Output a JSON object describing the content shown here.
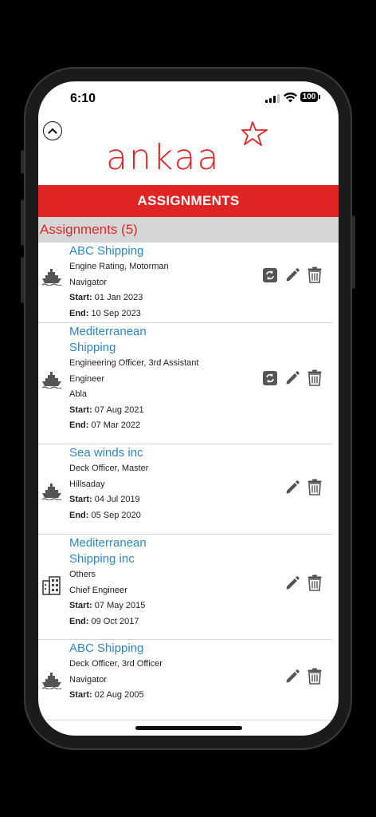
{
  "status": {
    "time": "6:10",
    "battery": "100"
  },
  "logo": {
    "text": "ankaa"
  },
  "header": {
    "banner": "ASSIGNMENTS",
    "list_title": "Assignments (5)"
  },
  "labels": {
    "start": "Start:",
    "end": "End:"
  },
  "assignments": [
    {
      "company": "ABC Shipping",
      "role": "Engine Rating, Motorman",
      "vessel": "Navigator",
      "start": "01 Jan 2023",
      "end": "10 Sep 2023",
      "icon": "ship-icon",
      "has_sync": true
    },
    {
      "company": "Mediterranean Shipping",
      "role": "Engineering Officer, 3rd Assistant Engineer",
      "vessel": "Abla",
      "start": "07 Aug 2021",
      "end": "07 Mar 2022",
      "icon": "ship-icon",
      "has_sync": true
    },
    {
      "company": "Sea winds inc",
      "role": "Deck Officer, Master",
      "vessel": "Hillsaday",
      "start": "04 Jul 2019",
      "end": "05 Sep 2020",
      "icon": "ship-icon",
      "has_sync": false
    },
    {
      "company": "Mediterranean Shipping inc",
      "role": "Others",
      "vessel": "Chief Engineer",
      "start": "07 May 2015",
      "end": "09 Oct 2017",
      "icon": "building-icon",
      "has_sync": false
    },
    {
      "company": "ABC Shipping",
      "role": "Deck Officer, 3rd Officer",
      "vessel": "Navigator",
      "start": "02 Aug 2005",
      "end": "",
      "icon": "ship-icon",
      "has_sync": false
    }
  ],
  "colors": {
    "brand": "#e02323",
    "link": "#2e86c1",
    "subhead_bg": "#d6d6d6"
  }
}
